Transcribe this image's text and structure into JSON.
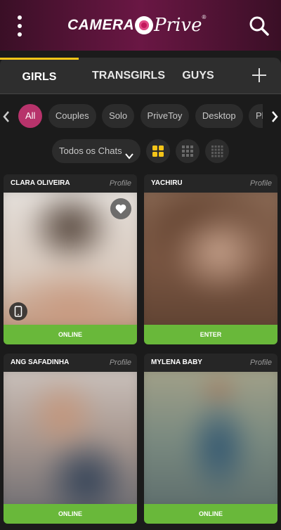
{
  "header": {
    "logo_camera": "CAMERA",
    "logo_prive": "Prive",
    "logo_reg": "®",
    "menu_icon": "more-vertical-icon",
    "search_icon": "search-icon"
  },
  "tabs": [
    {
      "label": "GIRLS",
      "active": true
    },
    {
      "label": "TRANSGIRLS",
      "active": false
    },
    {
      "label": "GUYS",
      "active": false
    }
  ],
  "add_tab_icon": "plus-icon",
  "filters": {
    "chips": [
      {
        "label": "All",
        "active": true
      },
      {
        "label": "Couples",
        "active": false
      },
      {
        "label": "Solo",
        "active": false
      },
      {
        "label": "PriveToy",
        "active": false
      },
      {
        "label": "Desktop",
        "active": false
      },
      {
        "label": "Phone",
        "active": false
      }
    ]
  },
  "view": {
    "dropdown_label": "Todos os Chats",
    "grid_options": [
      "grid-2-icon",
      "grid-3-icon",
      "grid-4-icon"
    ],
    "selected_grid": "grid-2-icon"
  },
  "cards": [
    {
      "name": "CLARA OLIVEIRA",
      "profile": "Profile",
      "status": "ONLINE",
      "favorite": true,
      "mobile": true
    },
    {
      "name": "YACHIRU",
      "profile": "Profile",
      "status": "ENTER",
      "favorite": false,
      "mobile": false
    },
    {
      "name": "ANG SAFADINHA",
      "profile": "Profile",
      "status": "ONLINE",
      "favorite": false,
      "mobile": false
    },
    {
      "name": "MYLENA BABY",
      "profile": "Profile",
      "status": "ONLINE",
      "favorite": false,
      "mobile": false
    }
  ],
  "colors": {
    "accent_pink": "#b7336b",
    "active_tab_underline": "#f5c518",
    "status_green": "#69b83a",
    "grid_selected": "#f5c518"
  }
}
